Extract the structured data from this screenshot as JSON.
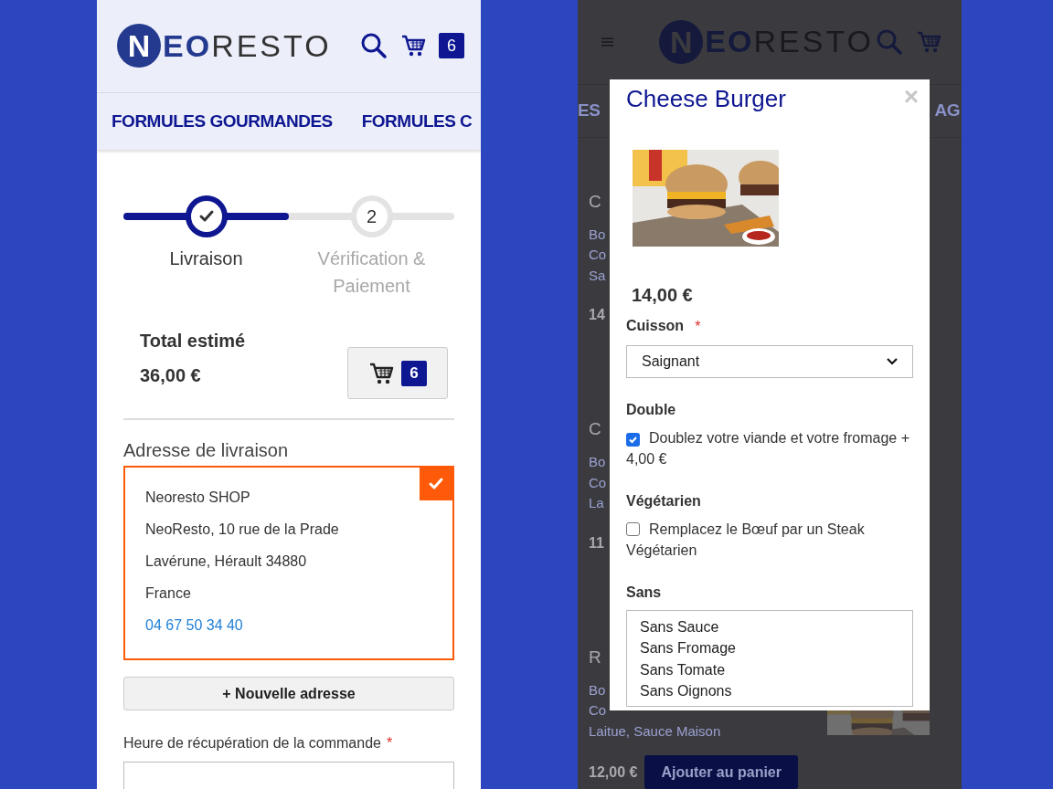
{
  "checkout": {
    "logo": {
      "mark": "N",
      "bold": "EO",
      "rest": "RESTO"
    },
    "cart_count": "6",
    "nav": [
      "FORMULES GOURMANDES",
      "FORMULES C"
    ],
    "steps": [
      {
        "label": "Livraison",
        "done": true
      },
      {
        "label": "Vérification & Paiement",
        "number": "2",
        "done": false
      }
    ],
    "progress": {
      "level": 0.5
    },
    "total": {
      "label": "Total estimé",
      "amount": "36,00 €",
      "cart_count": "6"
    },
    "address": {
      "title": "Adresse de livraison",
      "selected": true,
      "lines": [
        "Neoresto SHOP",
        "NeoResto, 10 rue de la Prade",
        "Lavérune, Hérault 34880",
        "France"
      ],
      "phone": "04 67 50 34 40"
    },
    "new_address_button": "+ Nouvelle adresse",
    "pickup": {
      "label": "Heure de récupération de la commande",
      "required_mark": "*"
    }
  },
  "menu_page": {
    "logo": {
      "mark": "N",
      "bold": "EO",
      "rest": "RESTO"
    },
    "nav": [
      "ES",
      "AG"
    ],
    "items": [
      {
        "title": "C",
        "lines": [
          "Bo",
          "Co",
          "Sa"
        ],
        "price": "14"
      },
      {
        "title": "C",
        "lines": [
          "Bo",
          "Co",
          "La"
        ],
        "price": "11"
      },
      {
        "title": "R",
        "lines": [
          "Bo",
          "Co",
          "Laitue, Sauce Maison"
        ],
        "price": "12,00 €",
        "button": "Ajouter au panier",
        "kind": "picture"
      }
    ]
  },
  "modal": {
    "title": "Cheese Burger",
    "close": "×",
    "price": "14,00 €",
    "options": [
      {
        "kind": "select",
        "label": "Cuisson",
        "required_mark": "*",
        "value": "Saignant"
      },
      {
        "kind": "checkbox",
        "label": "Double",
        "text": "Doublez votre viande et votre fromage + 4,00 €",
        "checked": true
      },
      {
        "kind": "checkbox",
        "label": "Végétarien",
        "text": "Remplacez le Bœuf par un Steak Végétarien",
        "checked": false
      },
      {
        "kind": "list",
        "label": "Sans",
        "choices": [
          "Sans Sauce",
          "Sans Fromage",
          "Sans Tomate",
          "Sans Oignons"
        ]
      }
    ]
  }
}
